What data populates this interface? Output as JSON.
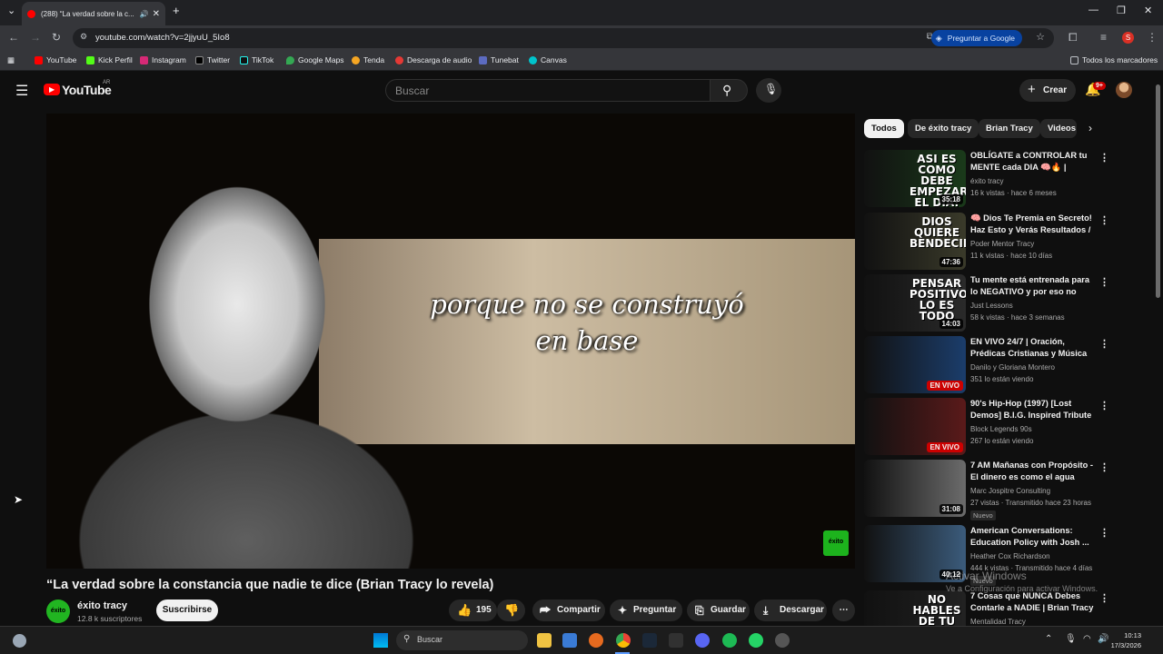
{
  "browser": {
    "tab_title": "(288) “La verdad sobre la c...",
    "url": "youtube.com/watch?v=2jjyuU_5Io8",
    "ask_google": "Preguntar a Google",
    "profile_initial": "S",
    "bookmarks": [
      "YouTube",
      "Kick Perfil",
      "Instagram",
      "Twitter",
      "TikTok",
      "Google Maps",
      "Tenda",
      "Descarga de audio",
      "Tunebat",
      "Canvas"
    ],
    "all_bookmarks": "Todos los marcadores"
  },
  "yt": {
    "logo": "YouTube",
    "region": "AR",
    "search_placeholder": "Buscar",
    "create": "Crear",
    "notif_count": "9+"
  },
  "video": {
    "caption_line1": "porque no se construyó",
    "caption_line2": "en base",
    "watermark": "éxito",
    "title": "“La verdad sobre la constancia que nadie te dice (Brian Tracy lo revela)",
    "channel": "éxito tracy",
    "avatar_text": "éxito",
    "subscribers": "12.8 k suscriptores",
    "subscribe": "Suscribirse",
    "likes": "195",
    "share": "Compartir",
    "ask": "Preguntar",
    "save": "Guardar",
    "download": "Descargar"
  },
  "chips": [
    "Todos",
    "De éxito tracy",
    "Brian Tracy",
    "Videos"
  ],
  "recommendations": [
    {
      "title": "OBLÍGATE a CONTROLAR tu MENTE cada DIA 🧠🔥 | Brian...",
      "channel": "éxito tracy",
      "meta": "16 k vistas · hace 6 meses",
      "duration": "35:18",
      "overlay": "ASI ES COMO DEBE EMPEZAR EL DIA!",
      "thumb": "#1a3a1a"
    },
    {
      "title": "🧠 Dios Te Premia en Secreto! Haz Esto y Verás Resultados / ...",
      "channel": "Poder Mentor Tracy",
      "meta": "11 k vistas · hace 10 días",
      "duration": "47:36",
      "overlay": "DIOS QUIERE BENDECIRTE",
      "thumb": "#3a3a2a"
    },
    {
      "title": "Tu mente está entrenada para lo NEGATIVO y por eso no avanz...",
      "channel": "Just Lessons",
      "meta": "58 k vistas · hace 3 semanas",
      "duration": "14:03",
      "overlay": "PENSAR POSITIVO LO ES TODO",
      "thumb": "#2a2a2a"
    },
    {
      "title": "EN VIVO 24/7 | Oración, Prédicas Cristianas y Música ...",
      "channel": "Danilo y Gloriana Montero",
      "meta": "351 lo están viendo",
      "live": "EN VIVO",
      "overlay": "",
      "thumb": "#1b3d6b"
    },
    {
      "title": "90's Hip-Hop (1997) [Lost Demos] B.I.G. Inspired Tribute ...",
      "channel": "Block Legends 90s",
      "meta": "267 lo están viendo",
      "live": "EN VIVO",
      "overlay": "",
      "thumb": "#5a1a1a"
    },
    {
      "title": "7 AM Mañanas con Propósito - El dinero es como el agua",
      "channel": "Marc Jospitre Consulting",
      "meta": "27 vistas · Transmitido hace 23 horas",
      "duration": "31:08",
      "badge": "Nuevo",
      "overlay": "",
      "thumb": "#6b6b6b"
    },
    {
      "title": "American Conversations: Education Policy with Josh ...",
      "channel": "Heather Cox Richardson",
      "meta": "444 k vistas · Transmitido hace 4 días",
      "duration": "40:12",
      "badge": "Nuevo",
      "overlay": "",
      "thumb": "#3b5b7b"
    },
    {
      "title": "7 Cosas que NUNCA Debes Contarle a NADIE | Brian Tracy",
      "channel": "Mentalidad Tracy",
      "meta": "",
      "overlay": "NO HABLES DE TU",
      "thumb": "#222"
    }
  ],
  "windows": {
    "activate_title": "Activar Windows",
    "activate_sub": "Ve a Configuración para activar Windows.",
    "search": "Buscar",
    "time": "10:13",
    "date": "17/3/2026"
  }
}
